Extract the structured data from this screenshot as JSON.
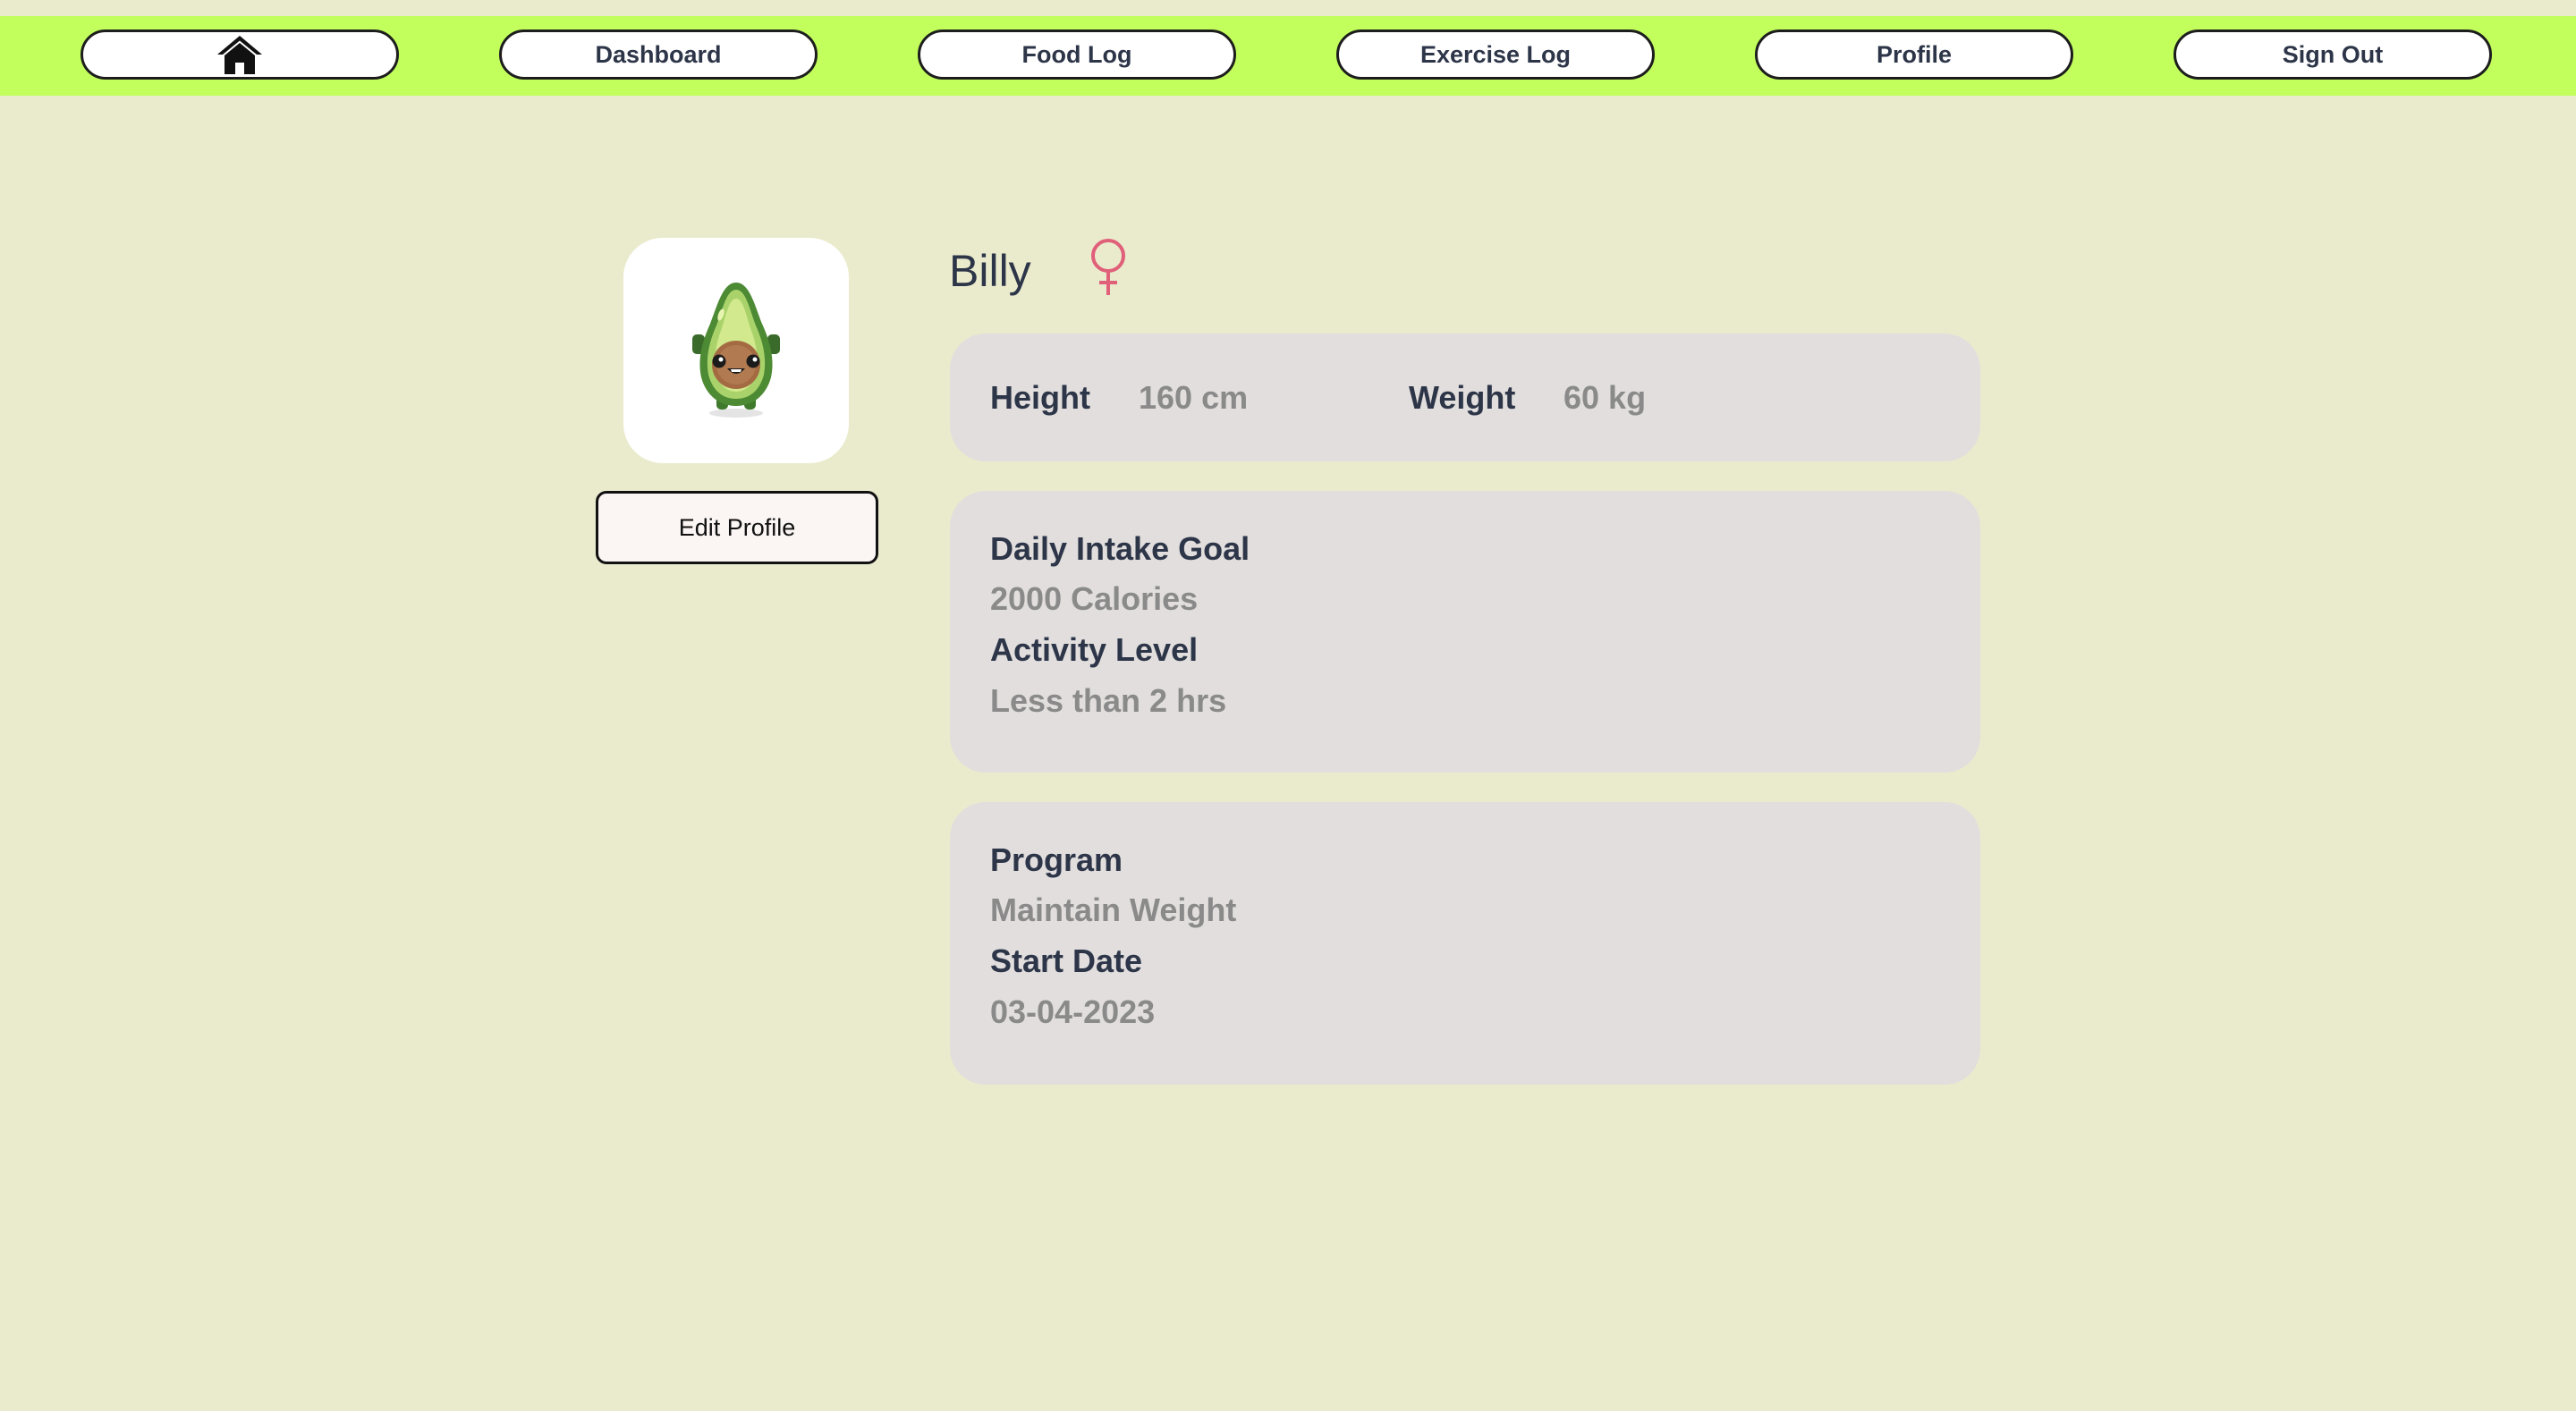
{
  "nav": {
    "home_icon": "home-icon",
    "items": [
      {
        "label": "Dashboard"
      },
      {
        "label": "Food Log"
      },
      {
        "label": "Exercise Log"
      },
      {
        "label": "Profile"
      },
      {
        "label": "Sign Out"
      }
    ]
  },
  "profile": {
    "avatar": "avocado-avatar",
    "edit_label": "Edit Profile",
    "name": "Billy",
    "gender_icon": "female-symbol-icon"
  },
  "measurements": {
    "height_label": "Height",
    "height_value": "160 cm",
    "weight_label": "Weight",
    "weight_value": "60 kg"
  },
  "goals": {
    "intake_label": "Daily Intake Goal",
    "intake_value": "2000 Calories",
    "activity_label": "Activity Level",
    "activity_value": "Less than 2 hrs"
  },
  "program": {
    "program_label": "Program",
    "program_value": "Maintain Weight",
    "start_label": "Start Date",
    "start_value": "03-04-2023"
  },
  "colors": {
    "background": "#eaebcd",
    "nav_bar": "#c2ff5d",
    "card": "#e1dedd",
    "heading_text": "#2d3548",
    "value_text": "#8a8a8a",
    "gender_icon": "#e0607a"
  }
}
